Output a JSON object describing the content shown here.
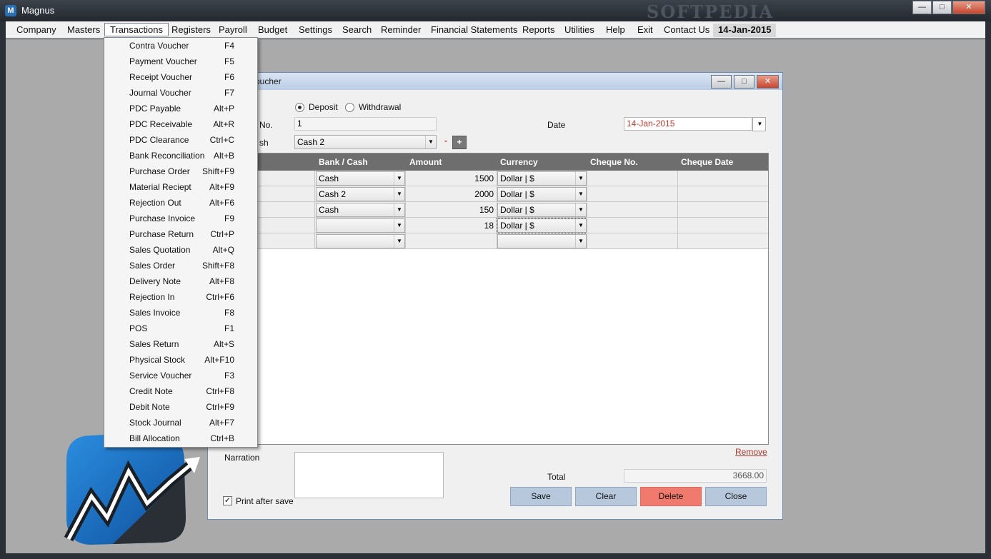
{
  "app": {
    "title": "Magnus",
    "watermark": "SOFTPEDIA",
    "window_buttons": {
      "minimize": "—",
      "restore": "□",
      "close": "✕"
    }
  },
  "menubar": {
    "items": [
      "Company",
      "Masters",
      "Transactions",
      "Registers",
      "Payroll",
      "Budget",
      "Settings",
      "Search",
      "Reminder",
      "Financial Statements",
      "Reports",
      "Utilities",
      "Help",
      "Exit",
      "Contact Us"
    ],
    "date": "14-Jan-2015",
    "active": "Transactions"
  },
  "transactions_menu": [
    {
      "label": "Contra Voucher",
      "key": "F4"
    },
    {
      "label": "Payment Voucher",
      "key": "F5"
    },
    {
      "label": "Receipt Voucher",
      "key": "F6"
    },
    {
      "label": "Journal Voucher",
      "key": "F7"
    },
    {
      "label": "PDC Payable",
      "key": "Alt+P"
    },
    {
      "label": "PDC Receivable",
      "key": "Alt+R"
    },
    {
      "label": "PDC Clearance",
      "key": "Ctrl+C"
    },
    {
      "label": "Bank Reconciliation",
      "key": "Alt+B"
    },
    {
      "label": "Purchase Order",
      "key": "Shift+F9"
    },
    {
      "label": "Material Reciept",
      "key": "Alt+F9"
    },
    {
      "label": "Rejection Out",
      "key": "Alt+F6"
    },
    {
      "label": "Purchase Invoice",
      "key": "F9"
    },
    {
      "label": "Purchase Return",
      "key": "Ctrl+P"
    },
    {
      "label": "Sales Quotation",
      "key": "Alt+Q"
    },
    {
      "label": "Sales Order",
      "key": "Shift+F8"
    },
    {
      "label": "Delivery Note",
      "key": "Alt+F8"
    },
    {
      "label": "Rejection In",
      "key": "Ctrl+F6"
    },
    {
      "label": "Sales Invoice",
      "key": "F8"
    },
    {
      "label": "POS",
      "key": "F1"
    },
    {
      "label": "Sales Return",
      "key": "Alt+S"
    },
    {
      "label": "Physical Stock",
      "key": "Alt+F10"
    },
    {
      "label": "Service Voucher",
      "key": "F3"
    },
    {
      "label": "Credit Note",
      "key": "Ctrl+F8"
    },
    {
      "label": "Debit Note",
      "key": "Ctrl+F9"
    },
    {
      "label": "Stock Journal",
      "key": "Alt+F7"
    },
    {
      "label": "Bill Allocation",
      "key": "Ctrl+B"
    }
  ],
  "voucher": {
    "title_fragment": "oucher",
    "radio_deposit": "Deposit",
    "radio_withdrawal": "Withdrawal",
    "selected_radio": "Deposit",
    "no_label_fragment": "No.",
    "no_value": "1",
    "date_label": "Date",
    "date_value": "14-Jan-2015",
    "cash_label_fragment": "sh",
    "cash_value": "Cash 2",
    "minus": "-",
    "plus": "+",
    "columns": [
      "Bank / Cash",
      "Amount",
      "Currency",
      "Cheque No.",
      "Cheque Date"
    ],
    "rows": [
      {
        "bank": "Cash",
        "amount": "1500",
        "currency": "Dollar | $"
      },
      {
        "bank": "Cash 2",
        "amount": "2000",
        "currency": "Dollar | $"
      },
      {
        "bank": "Cash",
        "amount": "150",
        "currency": "Dollar | $"
      },
      {
        "bank": "",
        "amount": "18",
        "currency": "Dollar | $"
      },
      {
        "bank": "",
        "amount": "",
        "currency": ""
      }
    ],
    "remove_link": "Remove",
    "narration_label": "Narration",
    "narration_value": "",
    "total_label": "Total",
    "total_value": "3668.00",
    "print_after_save": "Print after save",
    "print_checked": true,
    "buttons": {
      "save": "Save",
      "clear": "Clear",
      "delete": "Delete",
      "close": "Close"
    }
  }
}
